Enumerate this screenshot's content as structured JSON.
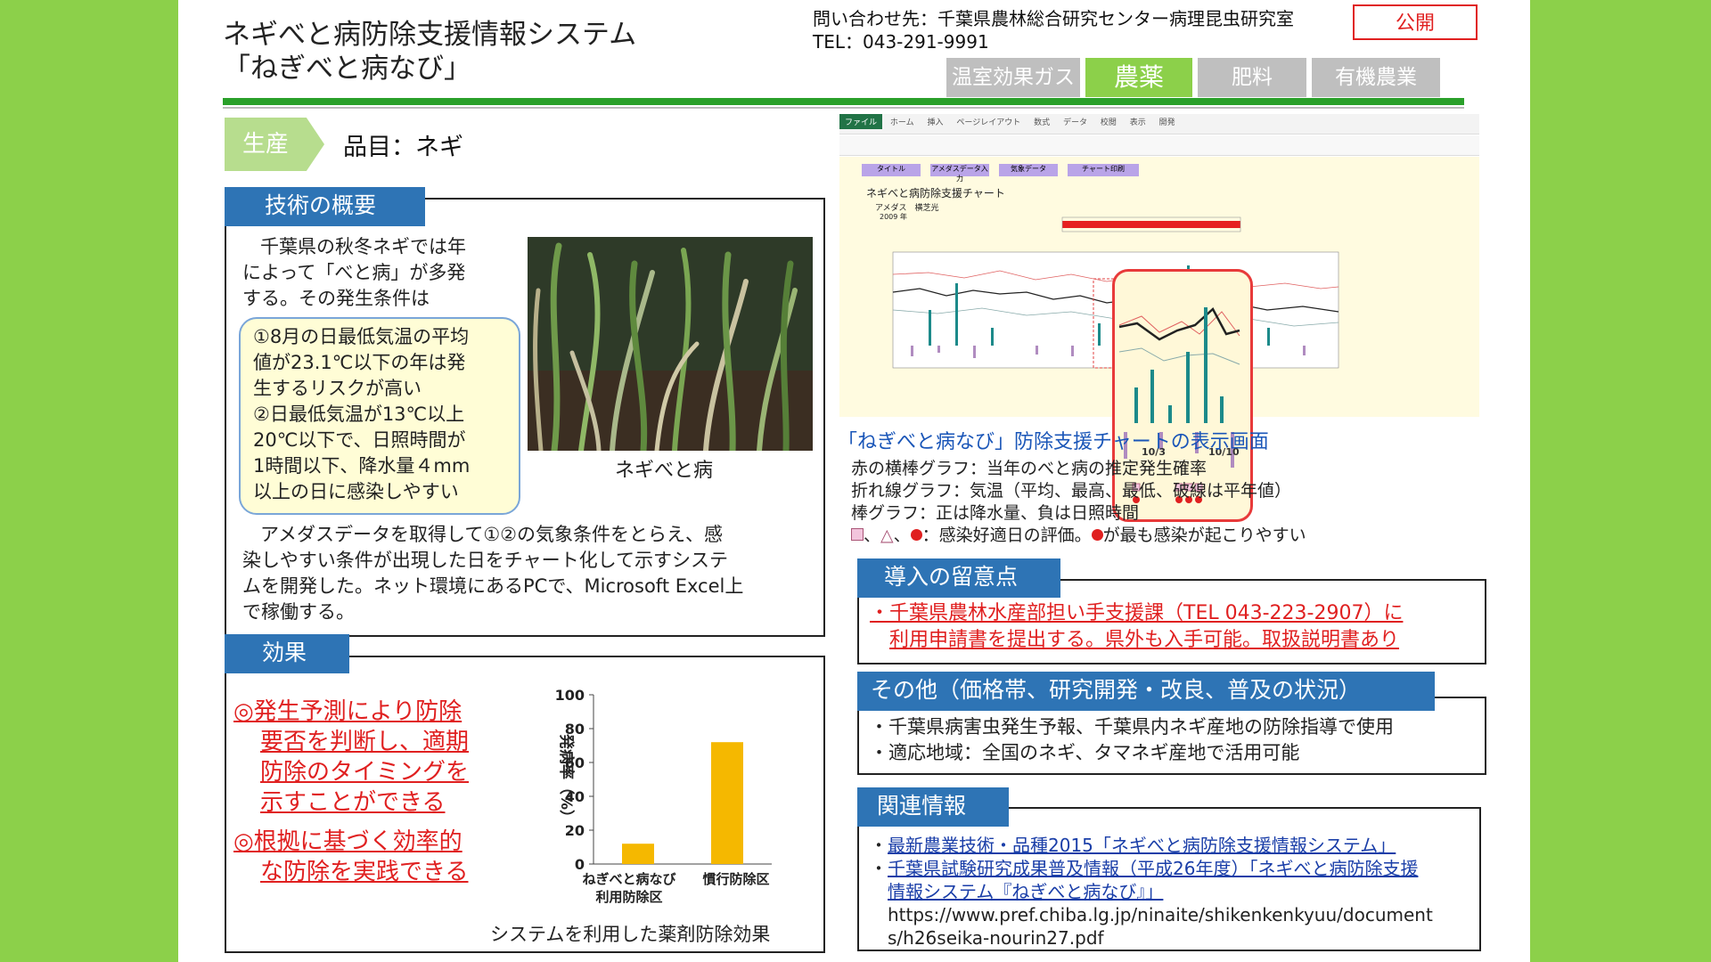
{
  "header": {
    "title_line1": "ネギべと病防除支援情報システム",
    "title_line2": "「ねぎべと病なび」",
    "contact_line1": "問い合わせ先：千葉県農林総合研究センター病理昆虫研究室",
    "contact_line2": "TEL：043-291-9991",
    "public_badge": "公開",
    "tabs": [
      {
        "label": "温室効果ガス",
        "active": false
      },
      {
        "label": "農薬",
        "active": true
      },
      {
        "label": "肥料",
        "active": false
      },
      {
        "label": "有機農業",
        "active": false
      }
    ]
  },
  "category": {
    "tag": "生産",
    "item": "品目：ネギ"
  },
  "overview": {
    "heading": "技術の概要",
    "intro_lines": [
      "千葉県の秋冬ネギでは年",
      "によって「べと病」が多発",
      "する。その発生条件は"
    ],
    "conditions": [
      "①8月の日最低気温の平均",
      "値が23.1℃以下の年は発",
      "生するリスクが高い",
      "②日最低気温が13℃以上",
      "20℃以下で、日照時間が",
      "1時間以下、降水量４mm",
      "以上の日に感染しやすい"
    ],
    "photo_caption": "ネギべと病",
    "body_lines": [
      "アメダスデータを取得して①②の気象条件をとらえ、感",
      "染しやすい条件が出現した日をチャート化して示すシステ",
      "ムを開発した。ネット環境にあるPCで、Microsoft Excel上",
      "で稼働する。"
    ]
  },
  "effect": {
    "heading": "効果",
    "points": [
      [
        "◎発生予測により防除",
        "要否を判断し、適期",
        "防除のタイミングを",
        "示すことができる"
      ],
      [
        "◎根拠に基づく効率的",
        "な防除を実践できる"
      ]
    ],
    "caption": "システムを利用した薬剤防除効果"
  },
  "chart_data": {
    "type": "bar",
    "categories": [
      "ねぎべと病なび利用防除区",
      "慣行防除区"
    ],
    "category_lines": [
      [
        "ねぎべと病なび",
        "利用防除区"
      ],
      [
        "慣行防除区"
      ]
    ],
    "values": [
      12,
      72
    ],
    "ylabel": "発病率（%）",
    "ylim": [
      0,
      100
    ],
    "yticks": [
      0,
      20,
      40,
      60,
      80,
      100
    ],
    "bar_color": "#f5b800",
    "grid": false
  },
  "screenshot": {
    "excel_tabs": [
      "ファイル",
      "ホーム",
      "挿入",
      "ページレイアウト",
      "数式",
      "データ",
      "校閲",
      "表示",
      "開発"
    ],
    "buttons": [
      "タイトル",
      "アメダスデータ入力",
      "気象データ",
      "チャート印刷"
    ],
    "chart_title": "ネギべと病防除支援チャート",
    "station": "アメダス　横芝光",
    "year": "2009 年",
    "mag_labels": [
      "10/3",
      "10/10"
    ]
  },
  "screen_notes": {
    "caption": "「ねぎべと病なび」防除支援チャートの表示画面",
    "lines": [
      "赤の横棒グラフ：当年のべと病の推定発生確率",
      "折れ線グラフ：気温（平均、最高、最低、破線は平年値）",
      "棒グラフ：正は降水量、負は日照時間"
    ],
    "legend_text": "：感染好適日の評価。",
    "legend_tail": "が最も感染が起こりやすい"
  },
  "cautions": {
    "heading": "導入の留意点",
    "lines": [
      "・千葉県農林水産部担い手支援課（TEL 043-223-2907）に",
      "利用申請書を提出する。県外も入手可能。取扱説明書あり"
    ]
  },
  "other": {
    "heading": "その他（価格帯、研究開発・改良、普及の状況）",
    "lines": [
      "・千葉県病害虫発生予報、千葉県内ネギ産地の防除指導で使用",
      "・適応地域：全国のネギ、タマネギ産地で活用可能"
    ]
  },
  "related": {
    "heading": "関連情報",
    "link1": "最新農業技術・品種2015「ネギべと病防除支援情報システム」",
    "link2_line1": "千葉県試験研究成果普及情報（平成26年度）「ネギべと病防除支援",
    "link2_line2": "情報システム『ねぎべと病なび』」",
    "url_line1": "https://www.pref.chiba.lg.jp/ninaite/shikenkenkyuu/document",
    "url_line2": "s/h26seika-nourin27.pdf"
  },
  "colors": {
    "accent_green": "#8cd04a",
    "header_blue": "#2e74b5",
    "alert_red": "#e02020",
    "link_blue": "#1a3ea8"
  }
}
